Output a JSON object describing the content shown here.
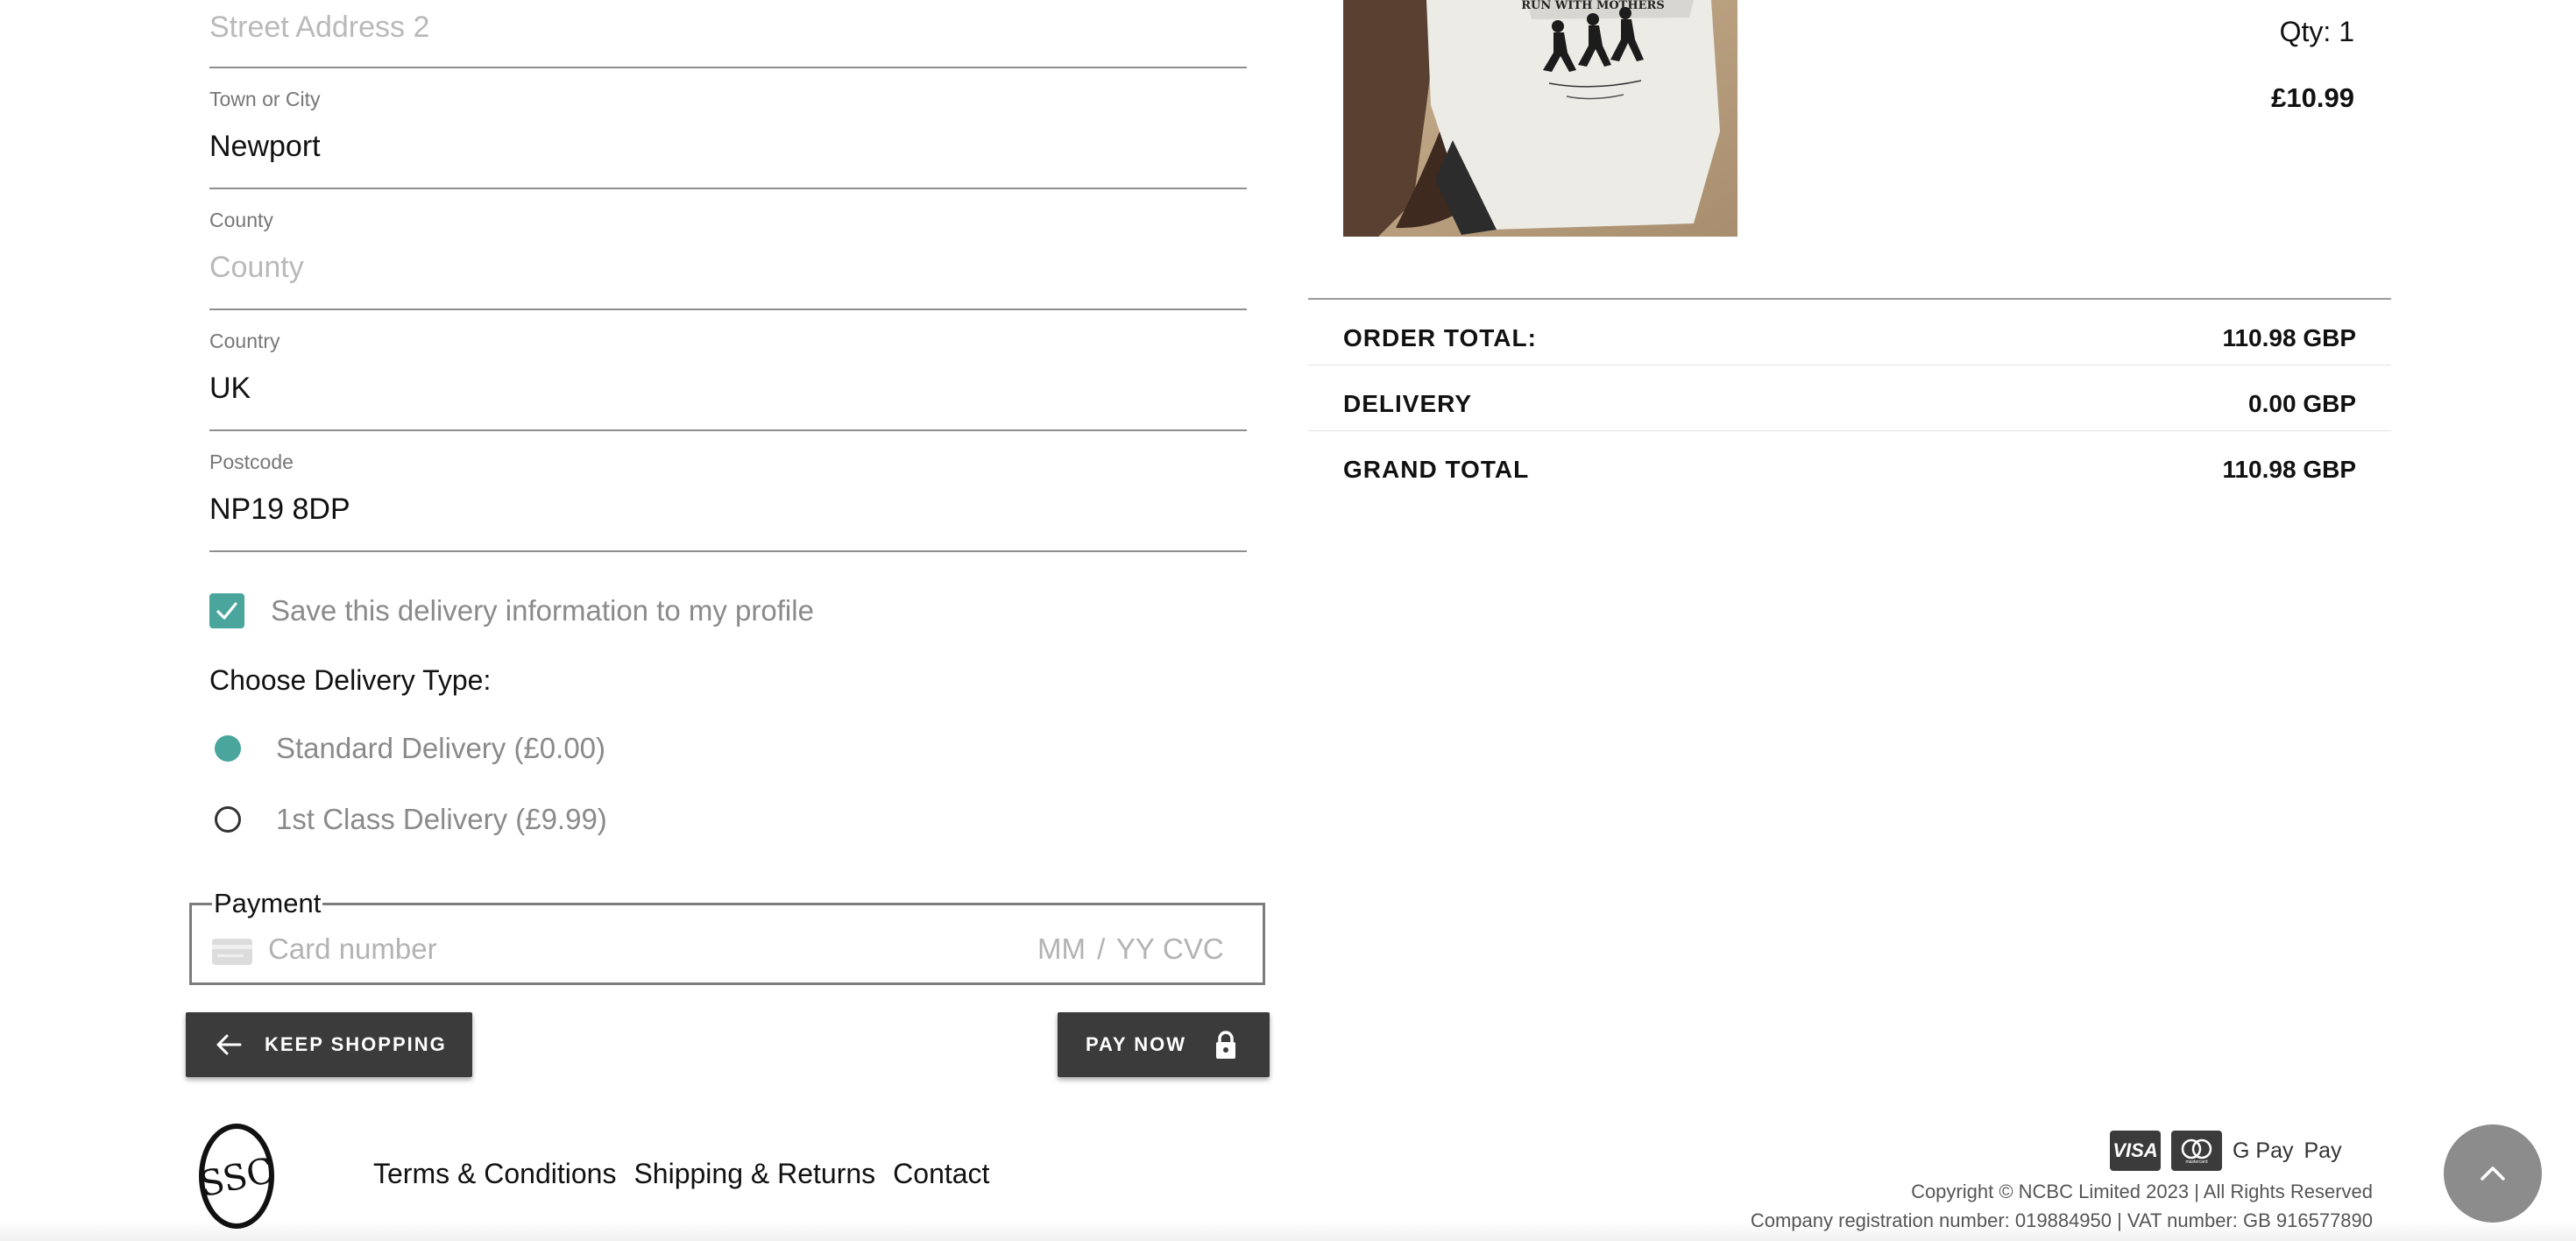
{
  "form": {
    "street2": {
      "placeholder": "Street Address 2"
    },
    "town": {
      "label": "Town or City",
      "value": "Newport"
    },
    "county": {
      "label": "County",
      "placeholder": "County"
    },
    "country": {
      "label": "Country",
      "value": "UK"
    },
    "postcode": {
      "label": "Postcode",
      "value": "NP19 8DP"
    },
    "save_info": {
      "label": "Save this delivery information to my profile",
      "checked": true
    },
    "delivery_type": {
      "heading": "Choose Delivery Type:",
      "options": [
        {
          "label": "Standard Delivery (£0.00)",
          "selected": true
        },
        {
          "label": "1st Class Delivery (£9.99)",
          "selected": false
        }
      ]
    },
    "payment": {
      "legend": "Payment",
      "card_placeholder": "Card number",
      "expiry_placeholder": "MM / YY",
      "cvc_placeholder": "CVC"
    },
    "buttons": {
      "keep_shopping": "KEEP SHOPPING",
      "pay_now": "PAY NOW"
    }
  },
  "order": {
    "item": {
      "image_text": "RUN WITH MOTHERS",
      "qty": "Qty: 1",
      "price": "£10.99"
    },
    "summary": [
      {
        "label": "ORDER TOTAL:",
        "value": "110.98 GBP"
      },
      {
        "label": "DELIVERY",
        "value": "0.00 GBP"
      },
      {
        "label": "GRAND TOTAL",
        "value": "110.98 GBP"
      }
    ]
  },
  "footer": {
    "logo_letters": "SSC",
    "links": [
      "Terms & Conditions",
      "Shipping & Returns",
      "Contact"
    ],
    "payment_methods": [
      "VISA",
      "mastercard",
      "G Pay",
      " Pay"
    ],
    "copyright": "Copyright © NCBC Limited 2023 | All Rights Reserved",
    "registration": "Company registration number: 019884950 | VAT number: GB 916577890"
  },
  "colors": {
    "accent": "#4aa59c",
    "button_bg": "#3b3b3b"
  },
  "icons": {
    "back": "arrow-left-icon",
    "lock": "lock-icon",
    "scroll_top": "chevron-up-icon",
    "card": "credit-card-icon"
  }
}
